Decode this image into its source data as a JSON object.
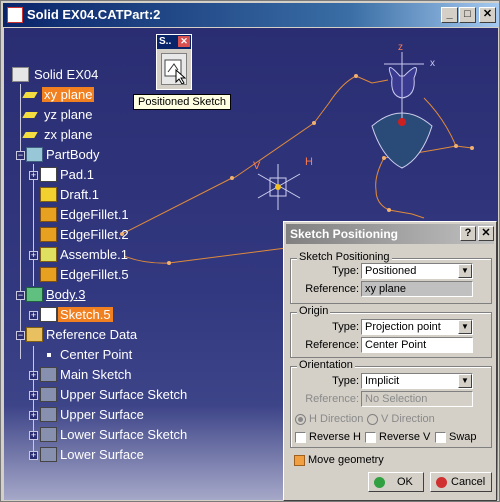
{
  "window": {
    "title": "Solid EX04.CATPart:2",
    "buttons": {
      "minimize": "_",
      "maximize": "□",
      "close": "✕"
    }
  },
  "tree": {
    "root": "Solid EX04",
    "items": [
      {
        "label": "xy plane",
        "selected": true
      },
      {
        "label": "yz plane"
      },
      {
        "label": "zx plane"
      },
      {
        "label": "PartBody"
      },
      {
        "label": "Pad.1"
      },
      {
        "label": "Draft.1"
      },
      {
        "label": "EdgeFillet.1"
      },
      {
        "label": "EdgeFillet.2"
      },
      {
        "label": "Assemble.1"
      },
      {
        "label": "EdgeFillet.5"
      },
      {
        "label": "Body.3"
      },
      {
        "label": "Sketch.5",
        "selected": true
      },
      {
        "label": "Reference Data"
      },
      {
        "label": "Center Point"
      },
      {
        "label": "Main Sketch"
      },
      {
        "label": "Upper Surface Sketch"
      },
      {
        "label": "Upper Surface"
      },
      {
        "label": "Lower Surface Sketch"
      },
      {
        "label": "Lower Surface"
      }
    ]
  },
  "axes": {
    "v": "V",
    "h": "H",
    "z": "z",
    "x": "x"
  },
  "mini_toolbar": {
    "title": "S..",
    "close": "✕"
  },
  "tooltip": "Positioned Sketch",
  "dialog": {
    "title": "Sketch Positioning",
    "help": "?",
    "close": "✕",
    "sketch_positioning": {
      "group_label": "Sketch Positioning",
      "type_label": "Type:",
      "type_value": "Positioned",
      "reference_label": "Reference:",
      "reference_value": "xy plane"
    },
    "origin": {
      "group_label": "Origin",
      "type_label": "Type:",
      "type_value": "Projection point",
      "reference_label": "Reference:",
      "reference_value": "Center Point"
    },
    "orientation": {
      "group_label": "Orientation",
      "type_label": "Type:",
      "type_value": "Implicit",
      "reference_label": "Reference:",
      "reference_value": "No Selection",
      "h_direction": "H Direction",
      "v_direction": "V Direction",
      "reverse_h": "Reverse H",
      "reverse_v": "Reverse V",
      "swap": "Swap"
    },
    "move_geometry": "Move geometry",
    "ok": "OK",
    "cancel": "Cancel"
  }
}
